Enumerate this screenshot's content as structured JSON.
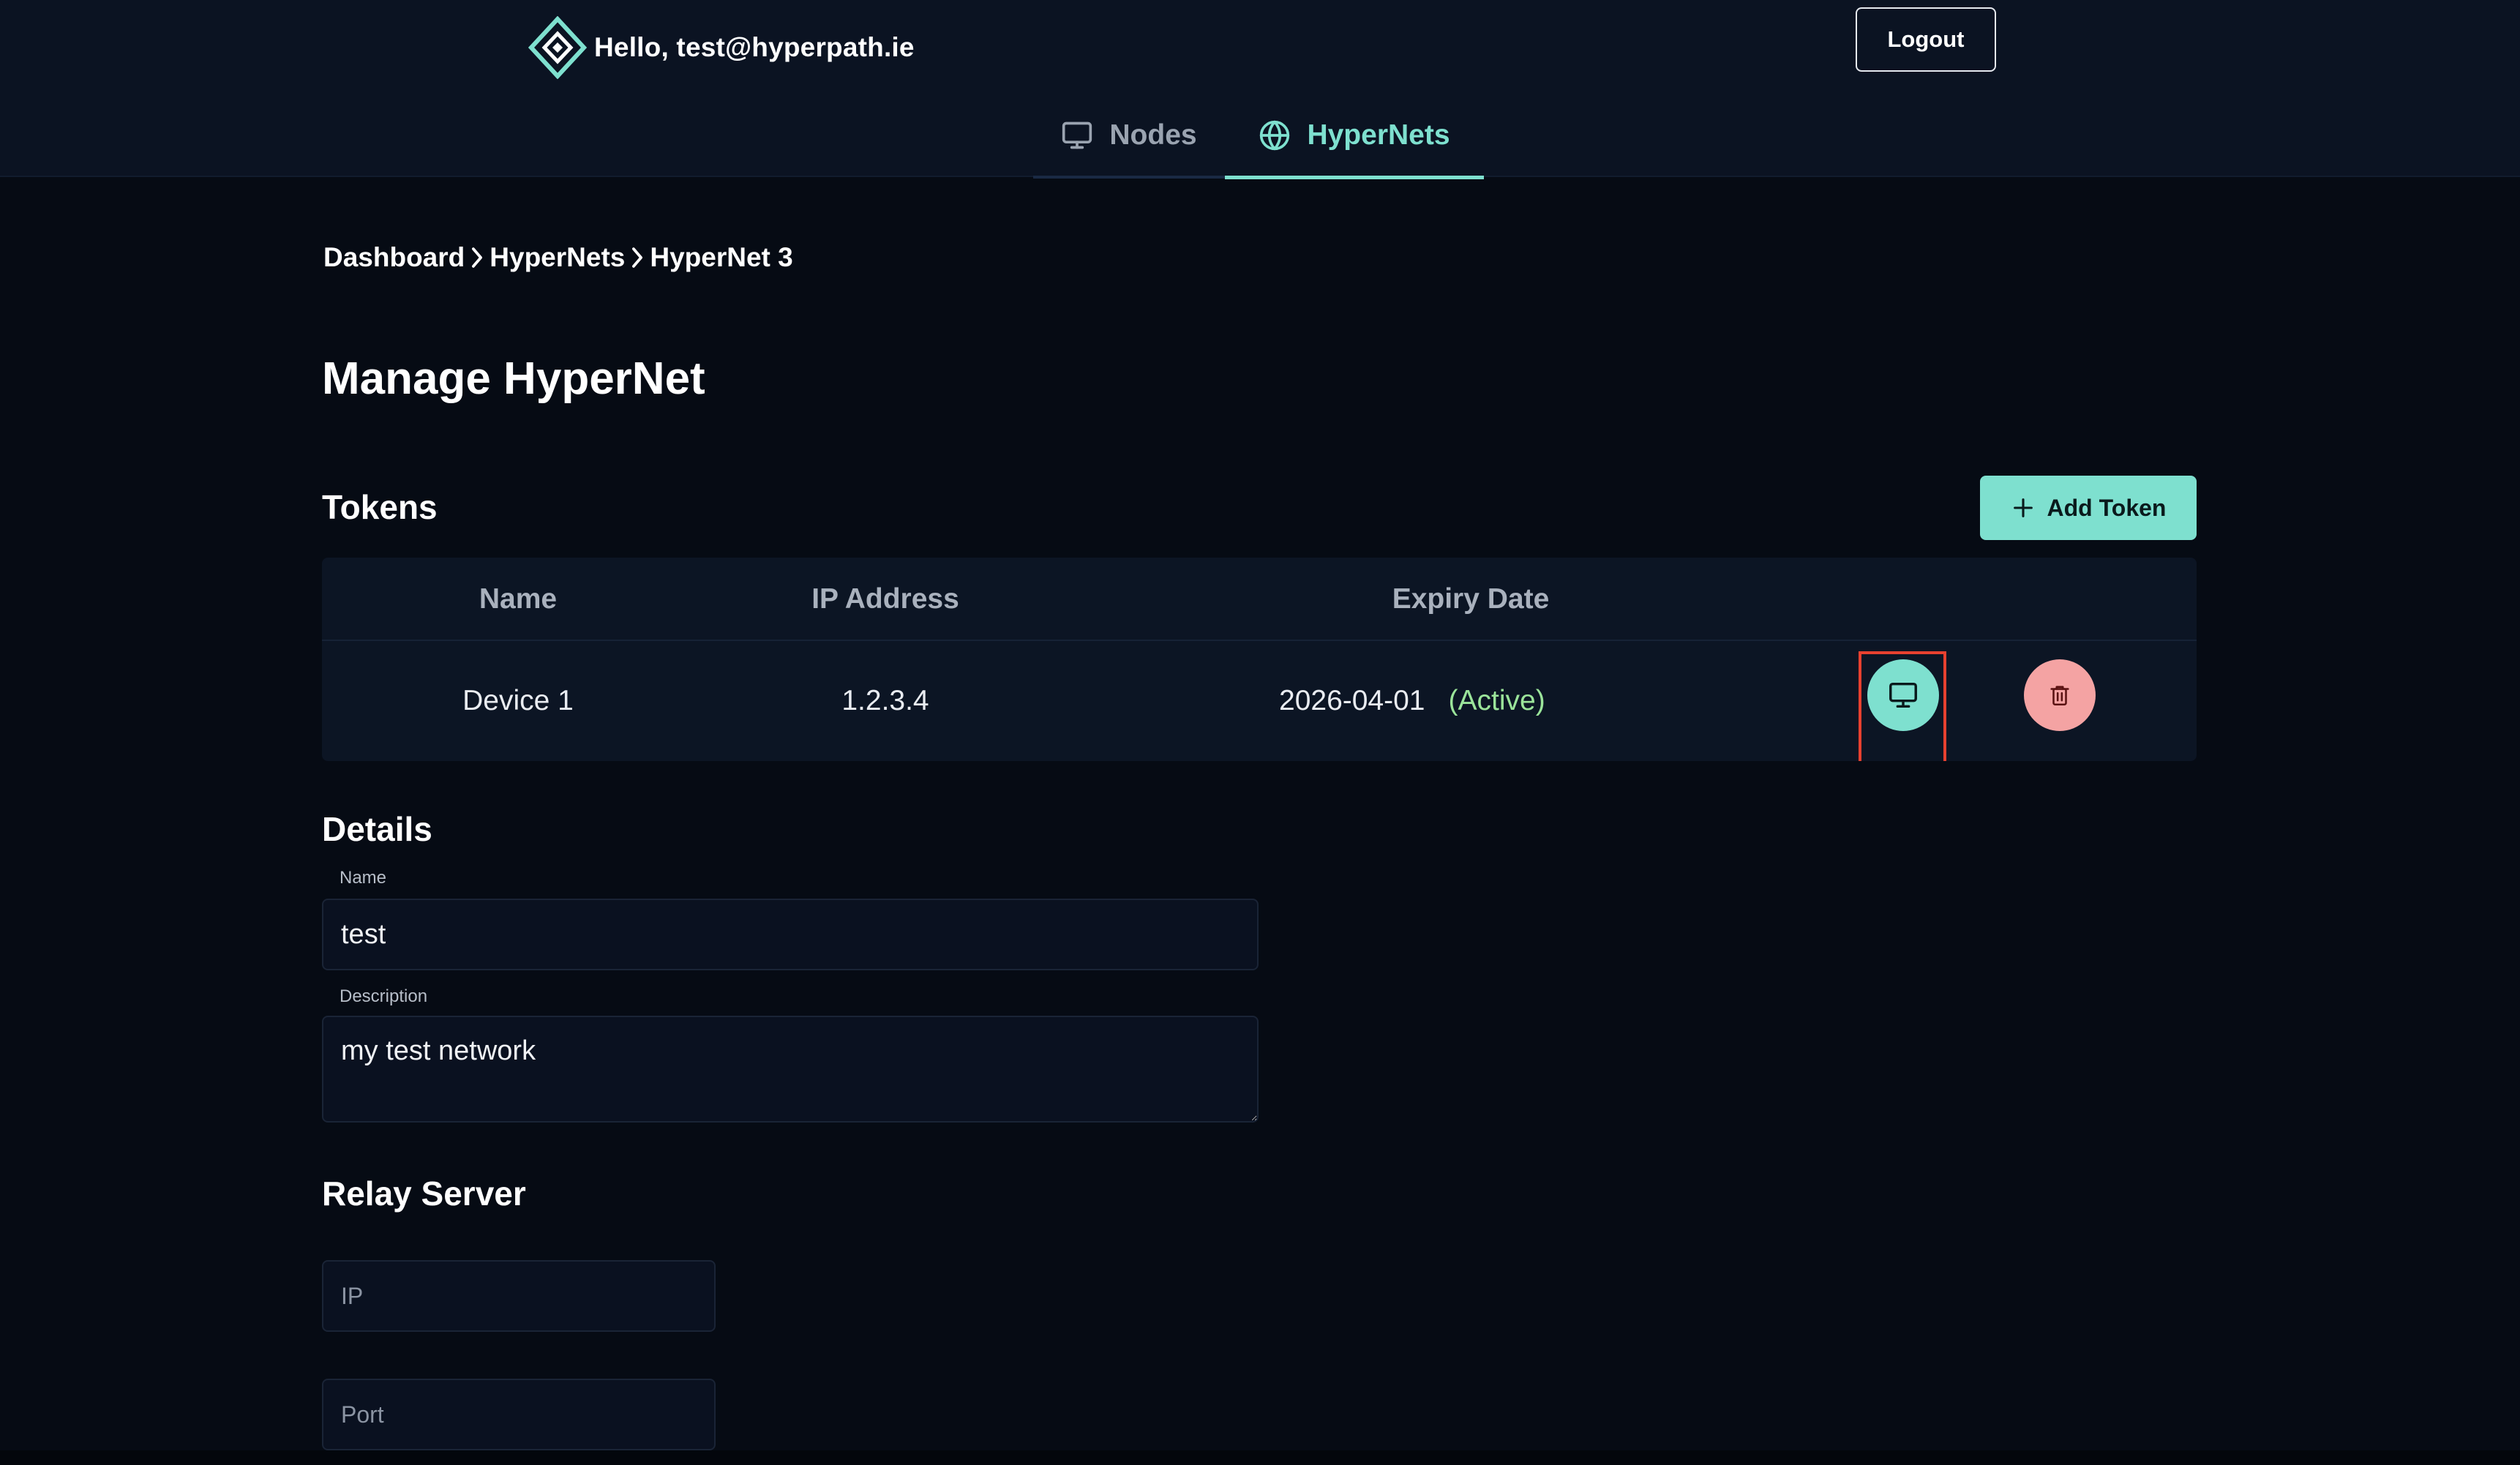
{
  "header": {
    "greeting": "Hello, test@hyperpath.ie",
    "logout_label": "Logout",
    "tabs": [
      {
        "label": "Nodes",
        "icon": "monitor-icon",
        "active": false
      },
      {
        "label": "HyperNets",
        "icon": "globe-icon",
        "active": true
      }
    ]
  },
  "breadcrumb": [
    "Dashboard",
    "HyperNets",
    "HyperNet 3"
  ],
  "page_title": "Manage HyperNet",
  "tokens": {
    "title": "Tokens",
    "add_label": "Add Token",
    "columns": [
      "Name",
      "IP Address",
      "Expiry Date"
    ],
    "rows": [
      {
        "name": "Device 1",
        "ip": "1.2.3.4",
        "expiry": "2026-04-01",
        "status": "(Active)"
      }
    ]
  },
  "details": {
    "title": "Details",
    "name_label": "Name",
    "name_value": "test",
    "description_label": "Description",
    "description_value": "my test network"
  },
  "relay": {
    "title": "Relay Server",
    "ip_placeholder": "IP",
    "port_placeholder": "Port"
  },
  "colors": {
    "accent": "#7ee0cf",
    "danger": "#f4a3a3",
    "status_active": "#9be49a",
    "background": "#060b14",
    "header": "#0b1322",
    "highlight": "#e8412f"
  }
}
